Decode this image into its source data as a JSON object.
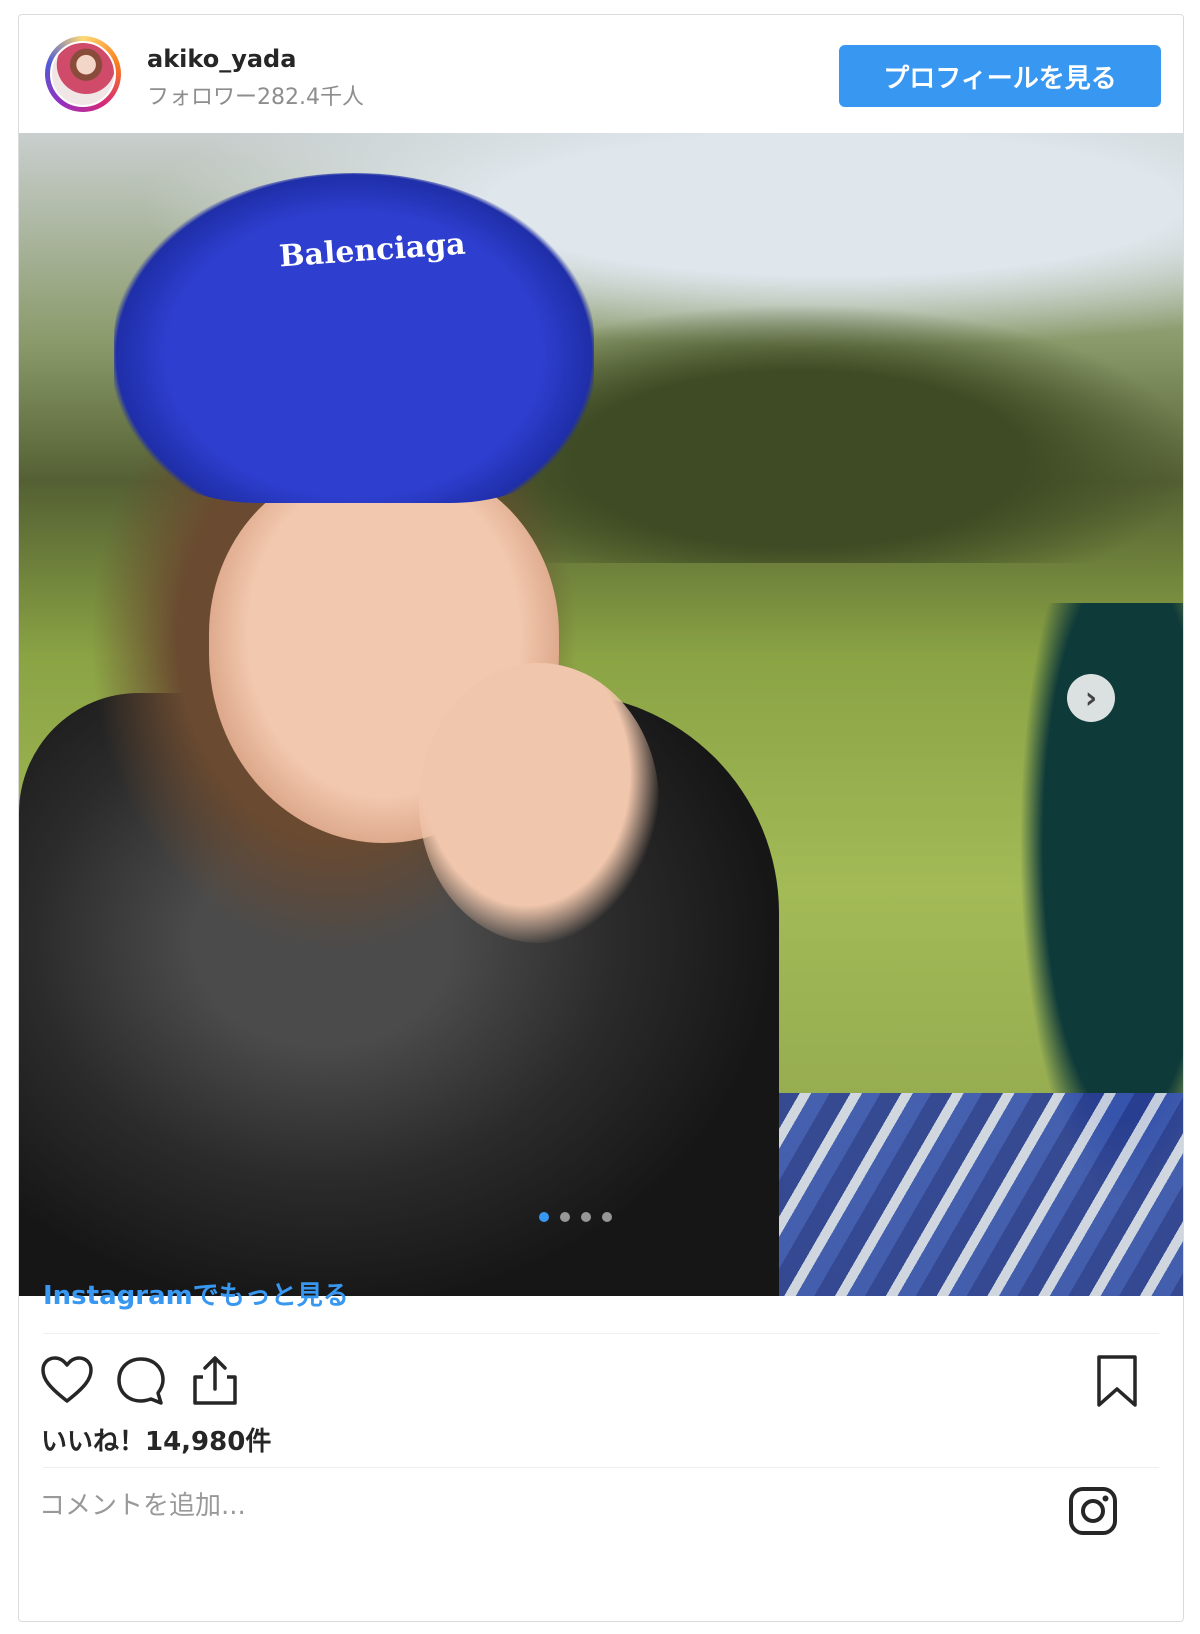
{
  "header": {
    "username": "akiko_yada",
    "followers": "フォロワー282.4千人",
    "profile_button": "プロフィールを見る"
  },
  "photo": {
    "cap_text": "Balenciaga",
    "carousel_dots": 4,
    "active_dot": 0
  },
  "more_link": "Instagramでもっと見る",
  "likes": "いいね！14,980件",
  "comment_placeholder": "コメントを追加...",
  "colors": {
    "accent": "#3897f0",
    "text": "#262626",
    "muted": "#8e8e8e"
  },
  "icons": [
    "heart-icon",
    "comment-icon",
    "share-icon",
    "bookmark-icon",
    "instagram-icon",
    "chevron-right-icon"
  ]
}
